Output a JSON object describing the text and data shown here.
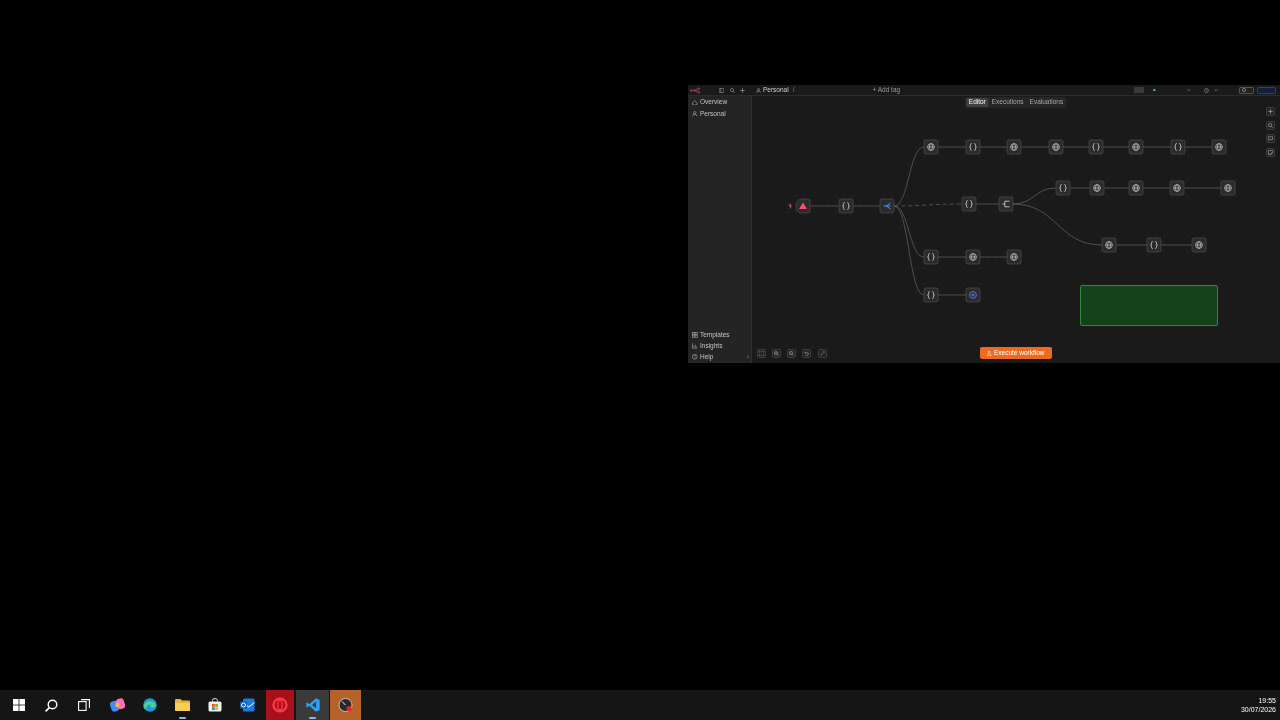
{
  "window": {
    "breadcrumb": {
      "folder": "Personal",
      "separator": "/",
      "add_tag": "+ Add tag"
    },
    "sidebar": {
      "top_items": [
        {
          "label": "Overview",
          "kind": "home",
          "selected": false
        },
        {
          "label": "Personal",
          "kind": "user",
          "selected": false
        }
      ],
      "bottom_items": [
        {
          "label": "Templates",
          "kind": "templates",
          "selected": false
        },
        {
          "label": "Insights",
          "kind": "insights",
          "selected": false
        },
        {
          "label": "Help",
          "kind": "help",
          "selected": false
        }
      ]
    },
    "tabs": [
      {
        "label": "Editor",
        "selected": true
      },
      {
        "label": "Executions",
        "selected": false
      },
      {
        "label": "Evaluations",
        "selected": false
      }
    ],
    "canvas": {
      "nodes": [
        {
          "kind": "trigger"
        },
        {
          "kind": "code"
        },
        {
          "kind": "switch"
        },
        {
          "kind": "http"
        },
        {
          "kind": "code"
        },
        {
          "kind": "http"
        },
        {
          "kind": "http"
        },
        {
          "kind": "code"
        },
        {
          "kind": "http"
        },
        {
          "kind": "code"
        },
        {
          "kind": "http"
        },
        {
          "kind": "code"
        },
        {
          "kind": "if"
        },
        {
          "kind": "code"
        },
        {
          "kind": "http"
        },
        {
          "kind": "http"
        },
        {
          "kind": "http"
        },
        {
          "kind": "http"
        },
        {
          "kind": "http"
        },
        {
          "kind": "code"
        },
        {
          "kind": "http"
        },
        {
          "kind": "code"
        },
        {
          "kind": "http"
        },
        {
          "kind": "http"
        },
        {
          "kind": "code"
        },
        {
          "kind": "api"
        }
      ],
      "execute_button": "Execute workflow"
    }
  },
  "taskbar": {
    "apps": [
      {
        "kind": "start",
        "open": false,
        "selected": false
      },
      {
        "kind": "search",
        "open": false,
        "selected": false
      },
      {
        "kind": "taskview",
        "open": false,
        "selected": false
      },
      {
        "kind": "assistant",
        "open": false,
        "selected": false
      },
      {
        "kind": "browser",
        "open": false,
        "selected": false
      },
      {
        "kind": "files",
        "open": true,
        "selected": false
      },
      {
        "kind": "store",
        "open": false,
        "selected": false
      },
      {
        "kind": "mail",
        "open": false,
        "selected": false
      },
      {
        "kind": "ring",
        "open": false,
        "selected": false
      },
      {
        "kind": "editor",
        "open": true,
        "selected": true
      },
      {
        "kind": "dial",
        "open": false,
        "selected": false
      }
    ],
    "clock": {
      "time": "19:55",
      "date": "30/07/2026"
    }
  }
}
